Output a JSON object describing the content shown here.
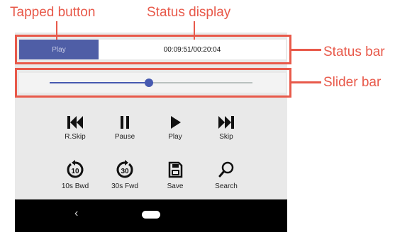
{
  "annotations": {
    "tapped_button": "Tapped button",
    "status_display": "Status display",
    "status_bar": "Status bar",
    "slider_bar": "Slider bar",
    "color": "#e8594a"
  },
  "status_bar": {
    "play_label": "Play",
    "time_text": "00:09:51/00:20:04",
    "accent": "#4f5ea6"
  },
  "slider": {
    "value_fraction": 0.49,
    "fill_color": "#4659b0",
    "track_color": "#b9c1bf"
  },
  "controls_row1": [
    {
      "icon": "skip-back-icon",
      "label": "R.Skip"
    },
    {
      "icon": "pause-icon",
      "label": "Pause"
    },
    {
      "icon": "play-icon",
      "label": "Play"
    },
    {
      "icon": "skip-forward-icon",
      "label": "Skip"
    }
  ],
  "controls_row2": [
    {
      "icon": "rewind-10-icon",
      "label": "10s Bwd",
      "badge": "10"
    },
    {
      "icon": "forward-30-icon",
      "label": "30s Fwd",
      "badge": "30"
    },
    {
      "icon": "save-icon",
      "label": "Save"
    },
    {
      "icon": "search-icon",
      "label": "Search"
    }
  ],
  "nav": {
    "back_glyph": "‹",
    "icons": [
      "back-icon",
      "home-icon"
    ]
  }
}
